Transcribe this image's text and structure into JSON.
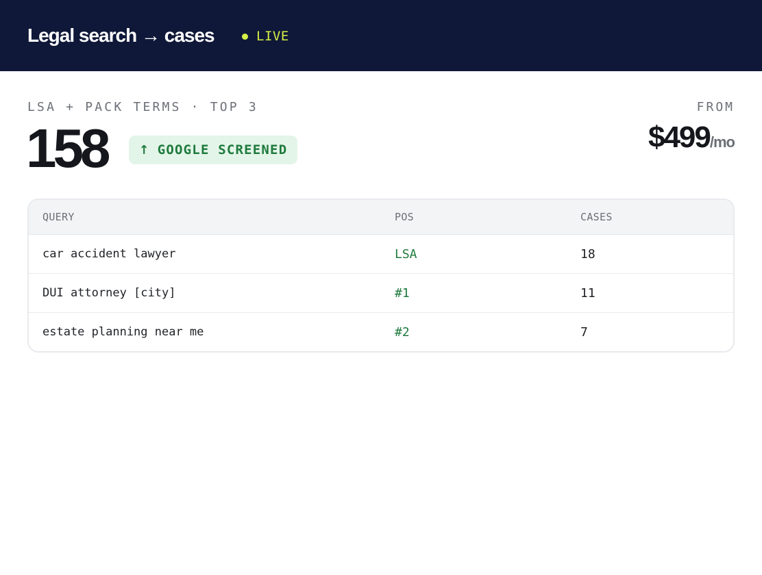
{
  "header": {
    "title": "Legal search → cases",
    "status": {
      "label": "LIVE",
      "color": "#d6f046"
    },
    "background": "#0f1838"
  },
  "metric": {
    "eyebrow": "LSA + PACK TERMS · TOP 3",
    "value": "158",
    "badge": {
      "arrow": "↑",
      "label": "GOOGLE SCREENED",
      "icon": "arrow-up-icon",
      "color": "#1e7a3c",
      "background": "#e3f5e9"
    }
  },
  "pricing": {
    "label": "FROM",
    "amount": "$499",
    "unit": "/mo"
  },
  "table": {
    "columns": {
      "query": "QUERY",
      "pos": "POS",
      "cases": "CASES"
    },
    "rows": [
      {
        "query": "car accident lawyer",
        "pos": "LSA",
        "cases": "18"
      },
      {
        "query": "DUI attorney [city]",
        "pos": "#1",
        "cases": "11"
      },
      {
        "query": "estate planning near me",
        "pos": "#2",
        "cases": "7"
      }
    ]
  }
}
